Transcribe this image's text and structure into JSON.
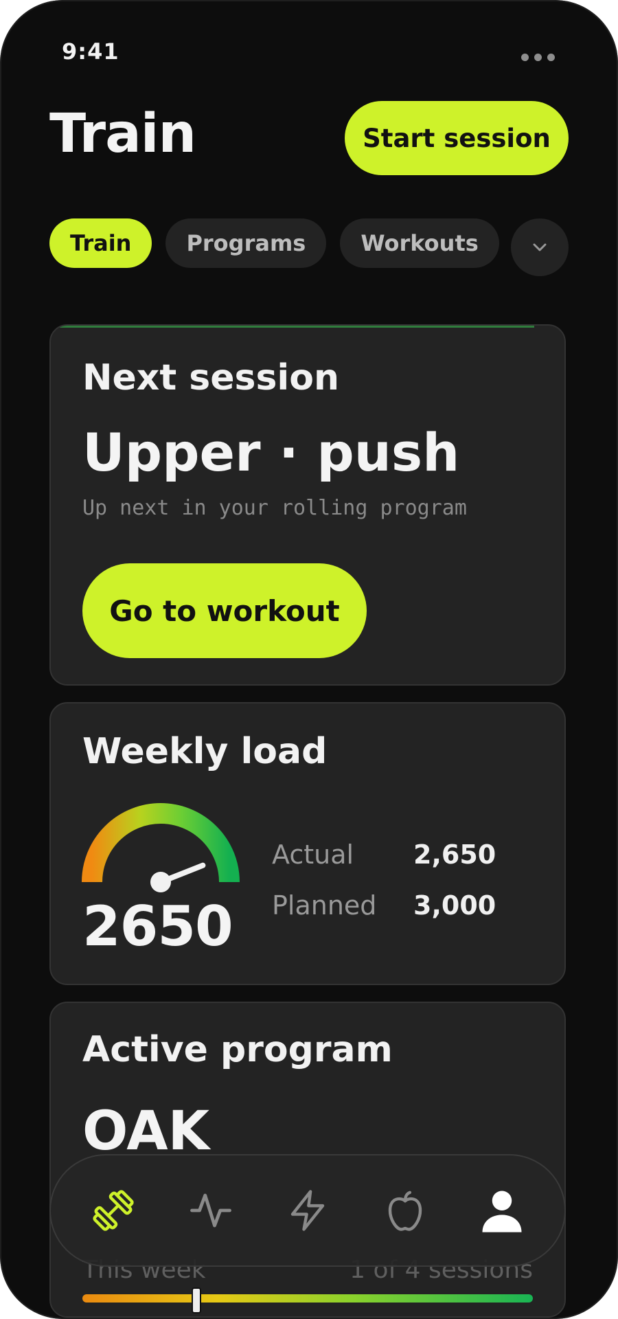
{
  "status_bar": {
    "time": "9:41"
  },
  "header": {
    "title": "Train",
    "start_label": "Start session"
  },
  "tabs": [
    {
      "label": "Train",
      "active": true
    },
    {
      "label": "Programs",
      "active": false
    },
    {
      "label": "Workouts",
      "active": false
    }
  ],
  "next_session": {
    "title": "Next session",
    "name": "Upper · push",
    "subtitle": "Up next in your rolling program",
    "button_label": "Go to workout"
  },
  "weekly_load": {
    "title": "Weekly load",
    "value": "2650",
    "gauge_fraction": 0.88,
    "actual_label": "Actual",
    "actual_value": "2,650",
    "planned_label": "Planned",
    "planned_value": "3,000"
  },
  "active_program": {
    "title": "Active program",
    "name": "OAK",
    "period_label": "This week",
    "progress_text": "1 of 4 sessions",
    "progress_fraction": 0.25
  },
  "nav": {
    "items": [
      "dumbbell-icon",
      "activity-icon",
      "lightning-icon",
      "apple-icon",
      "profile-icon"
    ],
    "active_index": 0
  },
  "colors": {
    "accent": "#cef22a",
    "background": "#0d0d0d",
    "card": "#232323"
  }
}
